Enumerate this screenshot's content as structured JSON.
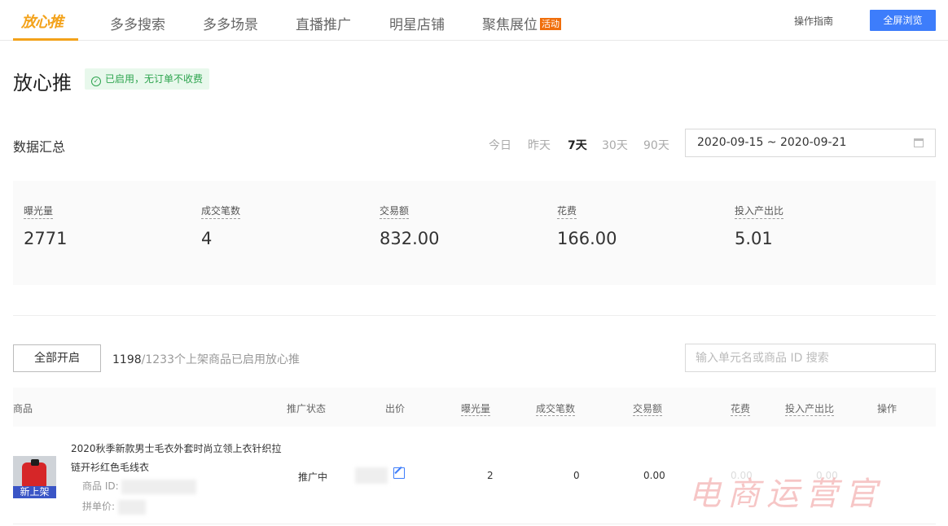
{
  "nav": {
    "logo_text": "放心推",
    "items": [
      "多多搜索",
      "多多场景",
      "直播推广",
      "明星店铺",
      "聚焦展位"
    ],
    "badge": "活动",
    "guide": "操作指南",
    "fullscreen": "全屏浏览",
    "accent_color": "#f3a21a"
  },
  "page": {
    "title": "放心推",
    "status": "已启用，无订单不收费"
  },
  "summary": {
    "title": "数据汇总",
    "ranges": [
      "今日",
      "昨天",
      "7天",
      "30天",
      "90天"
    ],
    "active_range": "7天",
    "date_range": "2020-09-15 ~ 2020-09-21",
    "metrics": [
      {
        "label": "曝光量",
        "value": "2771"
      },
      {
        "label": "成交笔数",
        "value": "4"
      },
      {
        "label": "交易额",
        "value": "832.00"
      },
      {
        "label": "花费",
        "value": "166.00"
      },
      {
        "label": "投入产出比",
        "value": "5.01"
      }
    ]
  },
  "toolbar": {
    "open_all": "全部开启",
    "enabled": "1198",
    "enabled_suffix": "/1233个上架商品已启用放心推",
    "search_placeholder": "输入单元名或商品 ID 搜索"
  },
  "table": {
    "headers": [
      "商品",
      "推广状态",
      "出价",
      "曝光量",
      "成交笔数",
      "交易额",
      "花费",
      "投入产出比",
      "操作"
    ],
    "rows": [
      {
        "name": "2020秋季新款男士毛衣外套时尚立领上衣针织拉链开衫红色毛线衣",
        "tag": "新上架",
        "id_label": "商品 ID:",
        "price_label": "拼单价:",
        "status": "推广中",
        "exposure": "2",
        "orders": "0",
        "gmv": "0.00",
        "spend": "0.00",
        "roi": "0.00"
      }
    ]
  },
  "watermark": "电商运营官"
}
